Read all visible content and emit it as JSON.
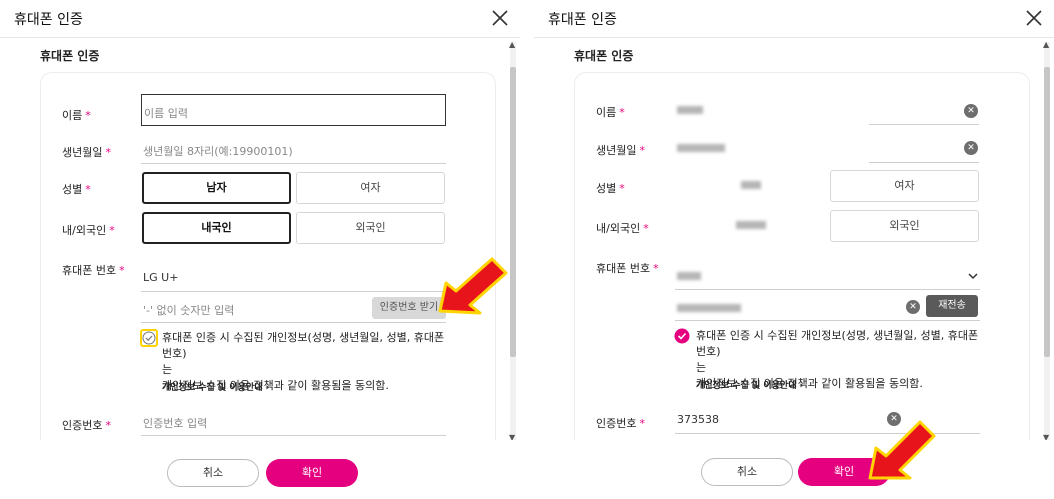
{
  "dialog": {
    "title": "휴대폰 인증",
    "section_title": "휴대폰 인증"
  },
  "labels": {
    "name": "이름",
    "birth": "생년월일",
    "gender": "성별",
    "nationality": "내/외국인",
    "phone": "휴대폰 번호",
    "auth_code": "인증번호",
    "required": "*"
  },
  "left": {
    "name_placeholder": "이름 입력",
    "birth_placeholder": "생년월일 8자리(예:19900101)",
    "gender_male": "남자",
    "gender_female": "여자",
    "nat_domestic": "내국인",
    "nat_foreign": "외국인",
    "carrier": "LG U+",
    "phone_placeholder": "'-' 없이 숫자만 입력",
    "request_code_button": "인증번호 받기",
    "consent_line1": "휴대폰 인증 시 수집된 개인정보(성명, 생년월일, 성별, 휴대폰번호)",
    "consent_line2": "는",
    "consent_line3": "개인정보 수집 이용 정책과 같이 활용됨을 동의함.",
    "consent_link": "개인정보 수집 및 이용안내",
    "auth_placeholder": "인증번호 입력"
  },
  "right": {
    "gender_female": "여자",
    "nat_foreign": "외국인",
    "resend_button": "재전송",
    "consent_line1": "휴대폰 인증 시 수집된 개인정보(성명, 생년월일, 성별, 휴대폰번호)",
    "consent_line2": "는",
    "consent_line3": "개인정보 수집 이용 정책과 같이 활용됨을 동의함.",
    "consent_link": "개인정보 수집 및 이용안내",
    "auth_code_value": "373538"
  },
  "footer": {
    "cancel": "취소",
    "confirm": "확인"
  },
  "icons": {
    "close": "close-icon",
    "clear": "clear-icon",
    "check": "check-circle-icon",
    "chevron": "chevron-down-icon",
    "pointer": "red-arrow-annotation"
  },
  "colors": {
    "accent": "#e4007f",
    "annotation_red": "#e8141b",
    "annotation_yellow": "#ffd400"
  }
}
